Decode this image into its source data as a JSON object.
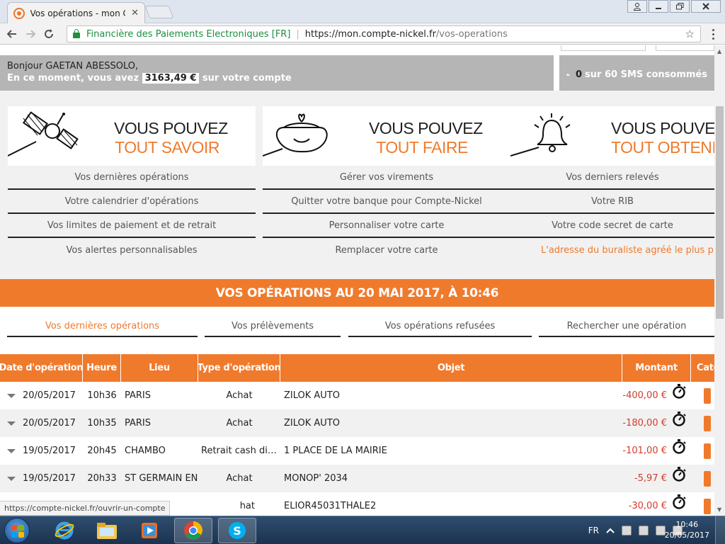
{
  "browser": {
    "tab_title": "Vos opérations - mon Co",
    "tab_close": "✕",
    "secure_name": "Financière des Paiements Electroniques [FR]",
    "url_host": "https://mon.compte-nickel.fr",
    "url_path": "/vos-operations",
    "status_url": "https://compte-nickel.fr/ouvrir-un-compte"
  },
  "header": {
    "greeting": "Bonjour GAETAN ABESSOLO,",
    "balance_prefix": "En ce moment, vous avez",
    "balance": "3163,49 €",
    "balance_suffix": "sur votre compte",
    "sms_count": "0",
    "sms_text": "sur 60 SMS consommés"
  },
  "features": [
    {
      "line1": "VOUS POUVEZ",
      "line2": "TOUT SAVOIR",
      "icon": "satellite-icon",
      "links": [
        "Vos dernières opérations",
        "Votre calendrier d'opérations",
        "Vos limites de paiement et de retrait",
        "Vos alertes personnalisables"
      ]
    },
    {
      "line1": "VOUS POUVEZ",
      "line2": "TOUT FAIRE",
      "icon": "purse-icon",
      "links": [
        "Gérer vos virements",
        "Quitter votre banque pour Compte-Nickel",
        "Personnaliser votre carte",
        "Remplacer votre carte"
      ]
    },
    {
      "line1": "VOUS POUVEZ",
      "line2": "TOUT OBTENIR",
      "icon": "bell-icon",
      "links": [
        "Vos derniers relevés",
        "Votre RIB",
        "Votre code secret de carte",
        "L'adresse du buraliste agréé le plus proche"
      ]
    }
  ],
  "operations": {
    "banner": "VOS OPÉRATIONS AU 20 MAI 2017, À 10:46",
    "tabs": [
      "Vos dernières opérations",
      "Vos prélèvements",
      "Vos opérations refusées",
      "Rechercher une opération"
    ],
    "columns": [
      "Date d'opération",
      "Heure",
      "Lieu",
      "Type d'opération",
      "Objet",
      "Montant",
      "Caté"
    ],
    "rows": [
      {
        "date": "20/05/2017",
        "time": "10h36",
        "place": "PARIS",
        "type": "Achat",
        "object": "ZILOK AUTO",
        "amount": "-400,00 €"
      },
      {
        "date": "20/05/2017",
        "time": "10h35",
        "place": "PARIS",
        "type": "Achat",
        "object": "ZILOK AUTO",
        "amount": "-180,00 €"
      },
      {
        "date": "19/05/2017",
        "time": "20h45",
        "place": "CHAMBO",
        "type": "Retrait cash dis...",
        "object": "1 PLACE DE LA MAIRIE",
        "amount": "-101,00 €"
      },
      {
        "date": "19/05/2017",
        "time": "20h33",
        "place": "ST GERMAIN EN",
        "type": "Achat",
        "object": "MONOP' 2034",
        "amount": "-5,97 €"
      },
      {
        "date": "",
        "time": "",
        "place": "",
        "type": "hat",
        "object": "ELIOR45031THALE2",
        "amount": "-30,00 €"
      }
    ]
  },
  "taskbar": {
    "lang": "FR",
    "time": "10:46",
    "date": "20/05/2017"
  }
}
